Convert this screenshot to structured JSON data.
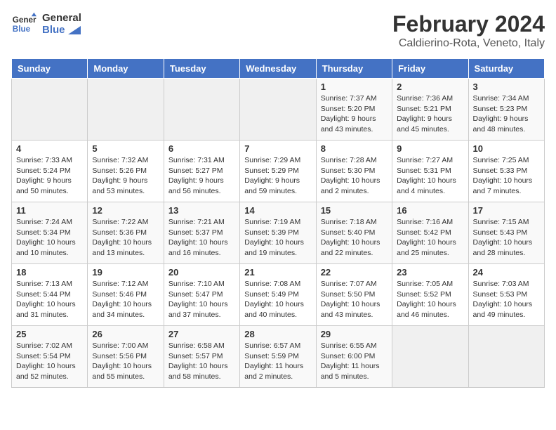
{
  "header": {
    "logo_line1": "General",
    "logo_line2": "Blue",
    "month_title": "February 2024",
    "location": "Caldierino-Rota, Veneto, Italy"
  },
  "days_of_week": [
    "Sunday",
    "Monday",
    "Tuesday",
    "Wednesday",
    "Thursday",
    "Friday",
    "Saturday"
  ],
  "weeks": [
    [
      {
        "day": "",
        "info": ""
      },
      {
        "day": "",
        "info": ""
      },
      {
        "day": "",
        "info": ""
      },
      {
        "day": "",
        "info": ""
      },
      {
        "day": "1",
        "info": "Sunrise: 7:37 AM\nSunset: 5:20 PM\nDaylight: 9 hours\nand 43 minutes."
      },
      {
        "day": "2",
        "info": "Sunrise: 7:36 AM\nSunset: 5:21 PM\nDaylight: 9 hours\nand 45 minutes."
      },
      {
        "day": "3",
        "info": "Sunrise: 7:34 AM\nSunset: 5:23 PM\nDaylight: 9 hours\nand 48 minutes."
      }
    ],
    [
      {
        "day": "4",
        "info": "Sunrise: 7:33 AM\nSunset: 5:24 PM\nDaylight: 9 hours\nand 50 minutes."
      },
      {
        "day": "5",
        "info": "Sunrise: 7:32 AM\nSunset: 5:26 PM\nDaylight: 9 hours\nand 53 minutes."
      },
      {
        "day": "6",
        "info": "Sunrise: 7:31 AM\nSunset: 5:27 PM\nDaylight: 9 hours\nand 56 minutes."
      },
      {
        "day": "7",
        "info": "Sunrise: 7:29 AM\nSunset: 5:29 PM\nDaylight: 9 hours\nand 59 minutes."
      },
      {
        "day": "8",
        "info": "Sunrise: 7:28 AM\nSunset: 5:30 PM\nDaylight: 10 hours\nand 2 minutes."
      },
      {
        "day": "9",
        "info": "Sunrise: 7:27 AM\nSunset: 5:31 PM\nDaylight: 10 hours\nand 4 minutes."
      },
      {
        "day": "10",
        "info": "Sunrise: 7:25 AM\nSunset: 5:33 PM\nDaylight: 10 hours\nand 7 minutes."
      }
    ],
    [
      {
        "day": "11",
        "info": "Sunrise: 7:24 AM\nSunset: 5:34 PM\nDaylight: 10 hours\nand 10 minutes."
      },
      {
        "day": "12",
        "info": "Sunrise: 7:22 AM\nSunset: 5:36 PM\nDaylight: 10 hours\nand 13 minutes."
      },
      {
        "day": "13",
        "info": "Sunrise: 7:21 AM\nSunset: 5:37 PM\nDaylight: 10 hours\nand 16 minutes."
      },
      {
        "day": "14",
        "info": "Sunrise: 7:19 AM\nSunset: 5:39 PM\nDaylight: 10 hours\nand 19 minutes."
      },
      {
        "day": "15",
        "info": "Sunrise: 7:18 AM\nSunset: 5:40 PM\nDaylight: 10 hours\nand 22 minutes."
      },
      {
        "day": "16",
        "info": "Sunrise: 7:16 AM\nSunset: 5:42 PM\nDaylight: 10 hours\nand 25 minutes."
      },
      {
        "day": "17",
        "info": "Sunrise: 7:15 AM\nSunset: 5:43 PM\nDaylight: 10 hours\nand 28 minutes."
      }
    ],
    [
      {
        "day": "18",
        "info": "Sunrise: 7:13 AM\nSunset: 5:44 PM\nDaylight: 10 hours\nand 31 minutes."
      },
      {
        "day": "19",
        "info": "Sunrise: 7:12 AM\nSunset: 5:46 PM\nDaylight: 10 hours\nand 34 minutes."
      },
      {
        "day": "20",
        "info": "Sunrise: 7:10 AM\nSunset: 5:47 PM\nDaylight: 10 hours\nand 37 minutes."
      },
      {
        "day": "21",
        "info": "Sunrise: 7:08 AM\nSunset: 5:49 PM\nDaylight: 10 hours\nand 40 minutes."
      },
      {
        "day": "22",
        "info": "Sunrise: 7:07 AM\nSunset: 5:50 PM\nDaylight: 10 hours\nand 43 minutes."
      },
      {
        "day": "23",
        "info": "Sunrise: 7:05 AM\nSunset: 5:52 PM\nDaylight: 10 hours\nand 46 minutes."
      },
      {
        "day": "24",
        "info": "Sunrise: 7:03 AM\nSunset: 5:53 PM\nDaylight: 10 hours\nand 49 minutes."
      }
    ],
    [
      {
        "day": "25",
        "info": "Sunrise: 7:02 AM\nSunset: 5:54 PM\nDaylight: 10 hours\nand 52 minutes."
      },
      {
        "day": "26",
        "info": "Sunrise: 7:00 AM\nSunset: 5:56 PM\nDaylight: 10 hours\nand 55 minutes."
      },
      {
        "day": "27",
        "info": "Sunrise: 6:58 AM\nSunset: 5:57 PM\nDaylight: 10 hours\nand 58 minutes."
      },
      {
        "day": "28",
        "info": "Sunrise: 6:57 AM\nSunset: 5:59 PM\nDaylight: 11 hours\nand 2 minutes."
      },
      {
        "day": "29",
        "info": "Sunrise: 6:55 AM\nSunset: 6:00 PM\nDaylight: 11 hours\nand 5 minutes."
      },
      {
        "day": "",
        "info": ""
      },
      {
        "day": "",
        "info": ""
      }
    ]
  ]
}
